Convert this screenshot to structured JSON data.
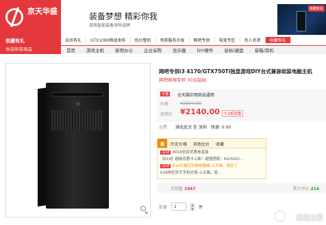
{
  "header": {
    "logo_text": "京天华盛",
    "favorite": "收藏有礼",
    "slogan": "装备梦想 精彩你我",
    "slogan_sub": "游戏智能装备领导品牌",
    "banner_badge": "收藏有礼"
  },
  "top_nav": [
    "会员有礼",
    "GTX1080畅战发布",
    "低价整机",
    "领券服务升级",
    "网吧专供",
    "电竞专区",
    "名人名单",
    "收藏有礼"
  ],
  "nav_bar": {
    "all_categories": "本店所有商品",
    "items": [
      "首页",
      "游戏主机",
      "家用办公",
      "企业采购",
      "显示器",
      "DIY硬件",
      "鼠标/键盘",
      "音箱/耳机"
    ]
  },
  "product": {
    "title": "网吧专供i3 4170/GTX750Ti独显游戏DIY台式兼容组装电脑主机",
    "subtitle": "网吧网咖专供 30台起拍",
    "service_badge": "天猫",
    "service_text": "全天猫实物商品通用",
    "price_label": "价格",
    "old_price": "¥2994.00",
    "promo_label": "促销价",
    "new_price": "¥2140.00",
    "discount": "7.2折优惠",
    "delivery_label": "运费",
    "delivery_from": "湖北武汉 至 深圳",
    "delivery_fee": "快递: 0.00"
  },
  "promo": {
    "tabs": [
      "历史价格",
      "其他比价",
      "收藏"
    ],
    "lines": [
      {
        "tag": "活动",
        "text": "8018全民优惠券直接"
      },
      {
        "tag": "",
        "text": "【618】超级优惠卡上新！超值搭配：8G/SSD/..."
      },
      {
        "tag": "活动",
        "text": "618天猫狂欢购电器城-上天猫，就好了"
      },
      {
        "tag": "",
        "text": "618抢狂欢节手机分场-上天猫，就..."
      }
    ]
  },
  "stats": {
    "sales_label": "月销量",
    "sales": "1947",
    "reviews_label": "累计评价",
    "reviews": "214"
  },
  "quantity": {
    "label": "数量",
    "value": "1",
    "unit": "件"
  },
  "watermark": "系统之家"
}
